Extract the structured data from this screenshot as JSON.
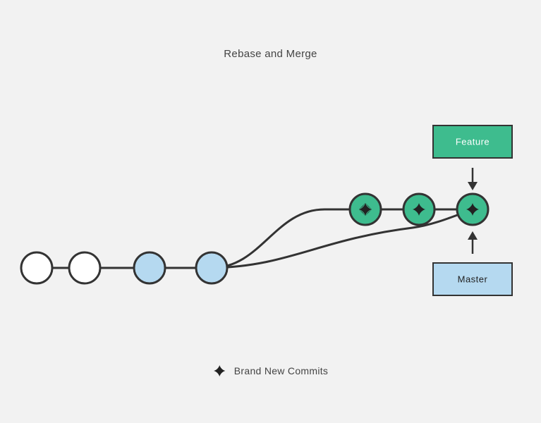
{
  "title": "Rebase and Merge",
  "branches": {
    "feature": {
      "label": "Feature",
      "color": "#3ebc8e"
    },
    "master": {
      "label": "Master",
      "color": "#b5d9f0"
    }
  },
  "legend": {
    "label": "Brand New Commits",
    "icon": "star-icon"
  },
  "diagram": {
    "commits": [
      {
        "id": "c1",
        "type": "base",
        "color": "white"
      },
      {
        "id": "c2",
        "type": "base",
        "color": "white"
      },
      {
        "id": "c3",
        "type": "master",
        "color": "blue"
      },
      {
        "id": "c4",
        "type": "master",
        "color": "blue"
      },
      {
        "id": "c5",
        "type": "rebased",
        "color": "green",
        "new_commit": true
      },
      {
        "id": "c6",
        "type": "rebased",
        "color": "green",
        "new_commit": true
      },
      {
        "id": "c7",
        "type": "merged",
        "color": "green",
        "new_commit": true
      }
    ],
    "colors": {
      "white": "#ffffff",
      "blue": "#b5d9f0",
      "green": "#3ebc8e",
      "stroke": "#333333"
    }
  }
}
